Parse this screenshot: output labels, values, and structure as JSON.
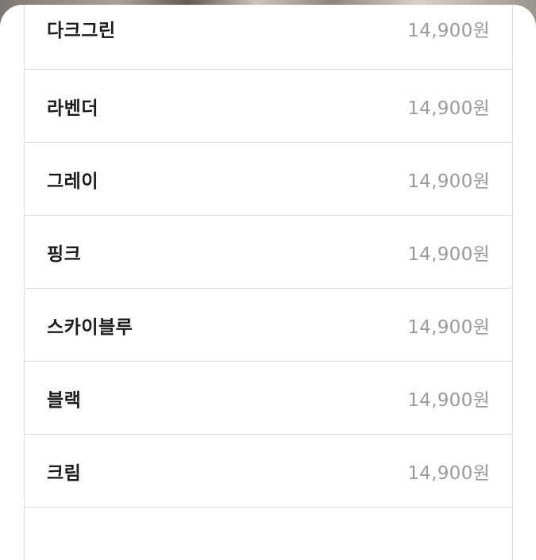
{
  "options": [
    {
      "name": "다크그린",
      "price": "14,900원"
    },
    {
      "name": "라벤더",
      "price": "14,900원"
    },
    {
      "name": "그레이",
      "price": "14,900원"
    },
    {
      "name": "핑크",
      "price": "14,900원"
    },
    {
      "name": "스카이블루",
      "price": "14,900원"
    },
    {
      "name": "블랙",
      "price": "14,900원"
    },
    {
      "name": "크림",
      "price": "14,900원"
    },
    {
      "name": "",
      "price": ""
    }
  ]
}
